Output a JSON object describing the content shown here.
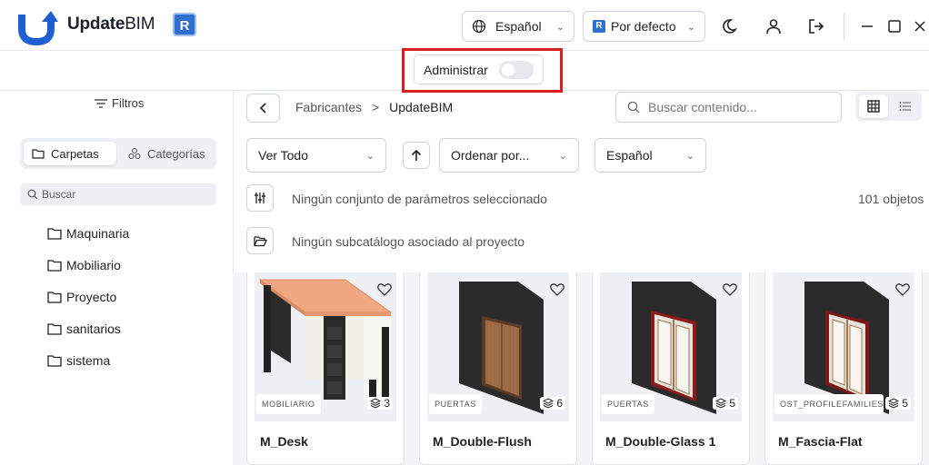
{
  "app": {
    "name_prefix": "Update",
    "name_suffix": "BIM",
    "badge": "R"
  },
  "titlebar": {
    "language": "Español",
    "profile": "Por defecto",
    "profile_badge": "R",
    "icons": [
      "moon-icon",
      "user-icon",
      "logout-icon",
      "minimize-icon",
      "maximize-icon",
      "close-icon"
    ]
  },
  "admin": {
    "label": "Administrar",
    "enabled": false,
    "highlight_color": "#d92020"
  },
  "sidebar": {
    "filters_label": "Filtros",
    "tabs": [
      {
        "label": "Carpetas",
        "active": true
      },
      {
        "label": "Categorías",
        "active": false
      }
    ],
    "search_placeholder": "Buscar",
    "folders": [
      "Maquinaria",
      "Mobiliario",
      "Proyecto",
      "sanitarios",
      "sistema"
    ]
  },
  "main": {
    "breadcrumb": [
      "Fabricantes",
      "UpdateBIM"
    ],
    "breadcrumb_sep": ">",
    "search_placeholder": "Buscar contenido...",
    "filter_view": "Ver Todo",
    "sort_label": "Ordenar por...",
    "language_filter": "Español",
    "params_text": "Ningún conjunto de parámetros seleccionado",
    "subcatalog_text": "Ningún subcatálogo asociado al proyecto",
    "object_count": "101 objetos"
  },
  "cards": [
    {
      "name": "M_Desk",
      "category": "MOBILIARIO",
      "versions": "3"
    },
    {
      "name": "M_Double-Flush",
      "category": "PUERTAS",
      "versions": "6"
    },
    {
      "name": "M_Double-Glass 1",
      "category": "PUERTAS",
      "versions": "5"
    },
    {
      "name": "M_Fascia-Flat",
      "category": "OST_PROFILEFAMILIES",
      "versions": "5"
    }
  ],
  "colors": {
    "brand_blue": "#2f6fd1",
    "logo_blue": "#1f5fd0"
  }
}
